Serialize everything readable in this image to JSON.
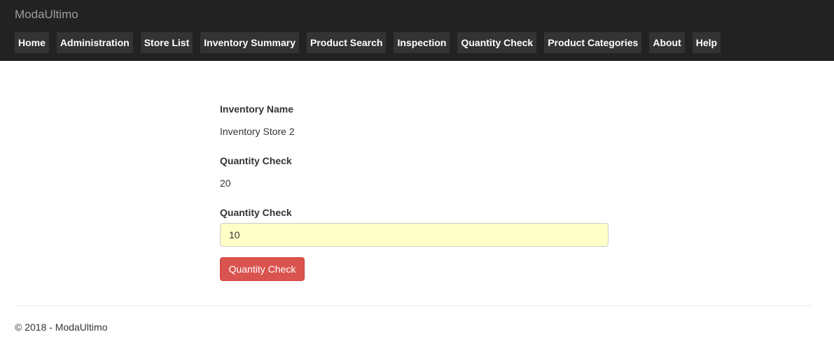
{
  "app": {
    "brand": "ModaUltimo"
  },
  "nav": {
    "items": [
      {
        "label": "Home"
      },
      {
        "label": "Administration"
      },
      {
        "label": "Store List"
      },
      {
        "label": "Inventory Summary"
      },
      {
        "label": "Product Search"
      },
      {
        "label": "Inspection"
      },
      {
        "label": "Quantity Check"
      },
      {
        "label": "Product Categories"
      },
      {
        "label": "About"
      },
      {
        "label": "Help"
      }
    ]
  },
  "form": {
    "inventory_name_label": "Inventory Name",
    "inventory_name_value": "Inventory Store 2",
    "quantity_check_label": "Quantity Check",
    "quantity_check_value": "20",
    "quantity_input_label": "Quantity Check",
    "quantity_input_value": "10",
    "submit_label": "Quantity Check"
  },
  "footer": {
    "text": "© 2018 - ModaUltimo"
  },
  "colors": {
    "navbar_bg": "#222222",
    "nav_item_bg": "#333333",
    "input_highlight": "#ffffc8",
    "danger_button": "#d9534f"
  }
}
